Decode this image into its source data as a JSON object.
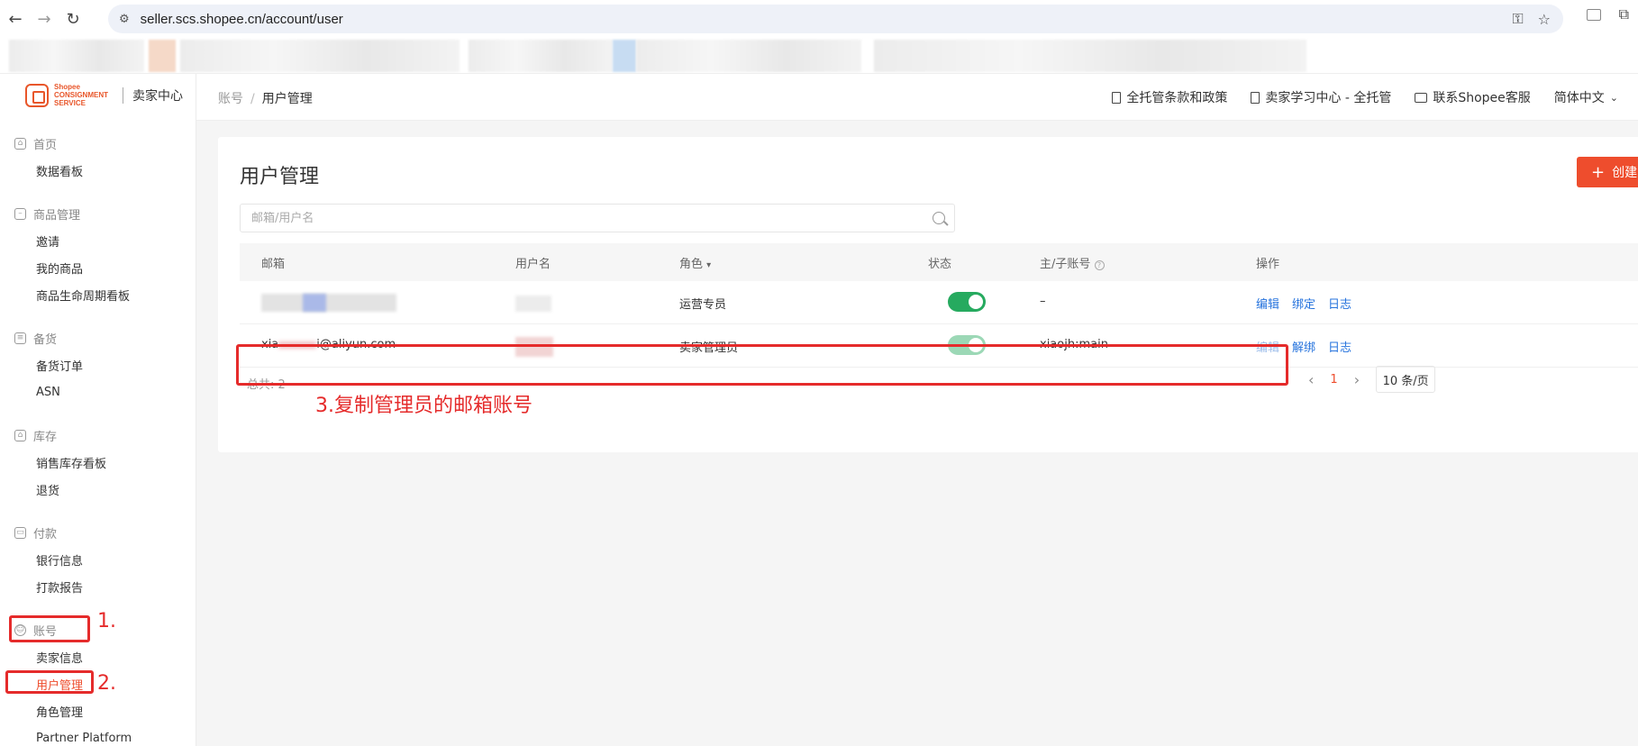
{
  "browser": {
    "url": "seller.scs.shopee.cn/account/user"
  },
  "sidebar": {
    "logo_text": "Shopee CONSIGNMENT SERVICE",
    "logo_center": "卖家中心",
    "groups": [
      {
        "label": "首页",
        "items": [
          "数据看板"
        ]
      },
      {
        "label": "商品管理",
        "items": [
          "邀请",
          "我的商品",
          "商品生命周期看板"
        ]
      },
      {
        "label": "备货",
        "items": [
          "备货订单",
          "ASN"
        ]
      },
      {
        "label": "库存",
        "items": [
          "销售库存看板",
          "退货"
        ]
      },
      {
        "label": "付款",
        "items": [
          "银行信息",
          "打款报告"
        ]
      },
      {
        "label": "账号",
        "items": [
          "卖家信息",
          "用户管理",
          "角色管理",
          "Partner Platform"
        ]
      }
    ]
  },
  "header": {
    "breadcrumb_root": "账号",
    "breadcrumb_current": "用户管理",
    "links": [
      "全托管条款和政策",
      "卖家学习中心 - 全托管",
      "联系Shopee客服",
      "简体中文"
    ]
  },
  "main": {
    "title": "用户管理",
    "create_label": "创建",
    "search_placeholder": "邮箱/用户名",
    "columns": [
      "邮箱",
      "用户名",
      "角色",
      "状态",
      "主/子账号",
      "操作"
    ],
    "rows": [
      {
        "email": "",
        "username": "",
        "role": "运营专员",
        "account": "–",
        "actions": [
          "编辑",
          "绑定",
          "日志"
        ]
      },
      {
        "email_prefix": "xia",
        "email_suffix": "i@aliyun.com",
        "username": "",
        "role": "卖家管理员",
        "account": "xiaojh:main",
        "actions": [
          "编辑",
          "解绑",
          "日志"
        ]
      }
    ],
    "total": "总共: 2",
    "page": "1",
    "page_size": "10 条/页"
  },
  "annotations": {
    "step1": "1.",
    "step2": "2.",
    "step3": "3.复制管理员的邮箱账号"
  },
  "colors": {
    "brand": "#ee4d2d",
    "annotation": "#e52b2b",
    "toggle_on": "#26aa5f",
    "link": "#2673dd"
  }
}
